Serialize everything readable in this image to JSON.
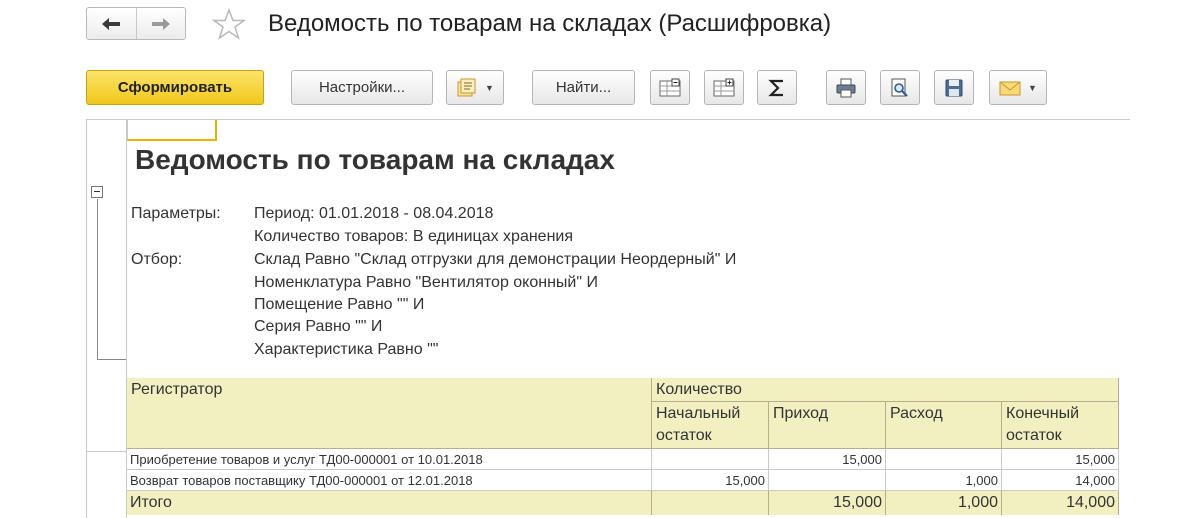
{
  "window": {
    "title": "Ведомость по товарам на складах (Расшифровка)"
  },
  "toolbar": {
    "generate_label": "Сформировать",
    "settings_label": "Настройки...",
    "find_label": "Найти..."
  },
  "report": {
    "title": "Ведомость по товарам на складах",
    "params_label": "Параметры:",
    "filter_label": "Отбор:",
    "params": [
      "Период: 01.01.2018 - 08.04.2018",
      "Количество товаров: В единицах хранения"
    ],
    "filters": [
      "Склад Равно \"Склад отгрузки для демонстрации Неордерный\" И",
      "Номенклатура Равно \"Вентилятор оконный\" И",
      "Помещение Равно \"\" И",
      "Серия Равно \"\" И",
      "Характеристика Равно \"\""
    ]
  },
  "table": {
    "headers": {
      "registrar": "Регистратор",
      "quantity": "Количество",
      "opening": "Начальный остаток",
      "income": "Приход",
      "expense": "Расход",
      "closing": "Конечный остаток"
    },
    "rows": [
      {
        "registrar": "Приобретение товаров и услуг ТД00-000001 от 10.01.2018",
        "opening": "",
        "income": "15,000",
        "expense": "",
        "closing": "15,000"
      },
      {
        "registrar": "Возврат товаров поставщику ТД00-000001 от 12.01.2018",
        "opening": "15,000",
        "income": "",
        "expense": "1,000",
        "closing": "14,000"
      }
    ],
    "total": {
      "label": "Итого",
      "opening": "",
      "income": "15,000",
      "expense": "1,000",
      "closing": "14,000"
    }
  },
  "icons": {
    "back": "arrow-left-icon",
    "forward": "arrow-right-icon",
    "favorite": "star-icon",
    "variants": "report-variants-icon",
    "collapse_groups": "collapse-groups-icon",
    "expand_groups": "expand-groups-icon",
    "sum": "sigma-icon",
    "print": "printer-icon",
    "preview": "print-preview-icon",
    "save": "floppy-disk-icon",
    "send": "envelope-icon"
  },
  "colors": {
    "primary_button": "#f5d63a",
    "table_header": "#f2efc0",
    "active_cell_border": "#e8b400"
  }
}
